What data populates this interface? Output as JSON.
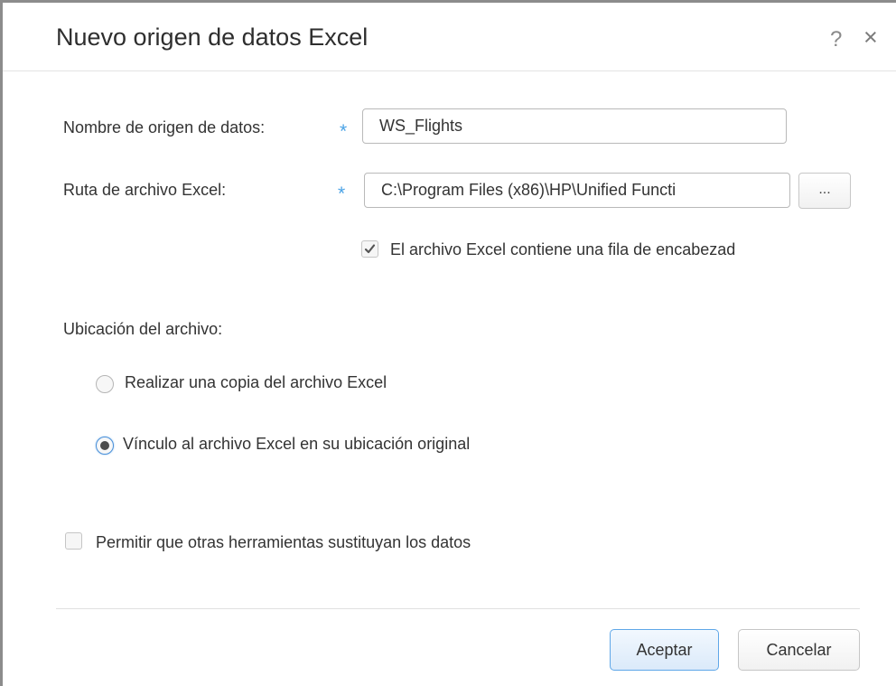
{
  "dialog": {
    "title": "Nuevo origen de datos Excel",
    "help_label": "?",
    "close_label": "×"
  },
  "form": {
    "name_label": "Nombre de origen de datos:",
    "name_value": "WS_Flights",
    "path_label": "Ruta de archivo Excel:",
    "path_value": "C:\\Program Files (x86)\\HP\\Unified Functi",
    "required_marker": "*",
    "browse_label": "...",
    "header_row_label": "El archivo Excel contiene una fila de encabezad",
    "header_row_checked": true
  },
  "location": {
    "label": "Ubicación del archivo:",
    "options": [
      {
        "label": "Realizar una copia del archivo Excel",
        "selected": false
      },
      {
        "label": "Vínculo al archivo Excel en su ubicación original",
        "selected": true
      }
    ]
  },
  "allow_replace": {
    "label": "Permitir que otras herramientas sustituyan los datos",
    "checked": false
  },
  "buttons": {
    "ok": "Aceptar",
    "cancel": "Cancelar"
  },
  "colors": {
    "required_marker": "#4ba3e6",
    "primary_button_border": "#5fa7e8"
  }
}
